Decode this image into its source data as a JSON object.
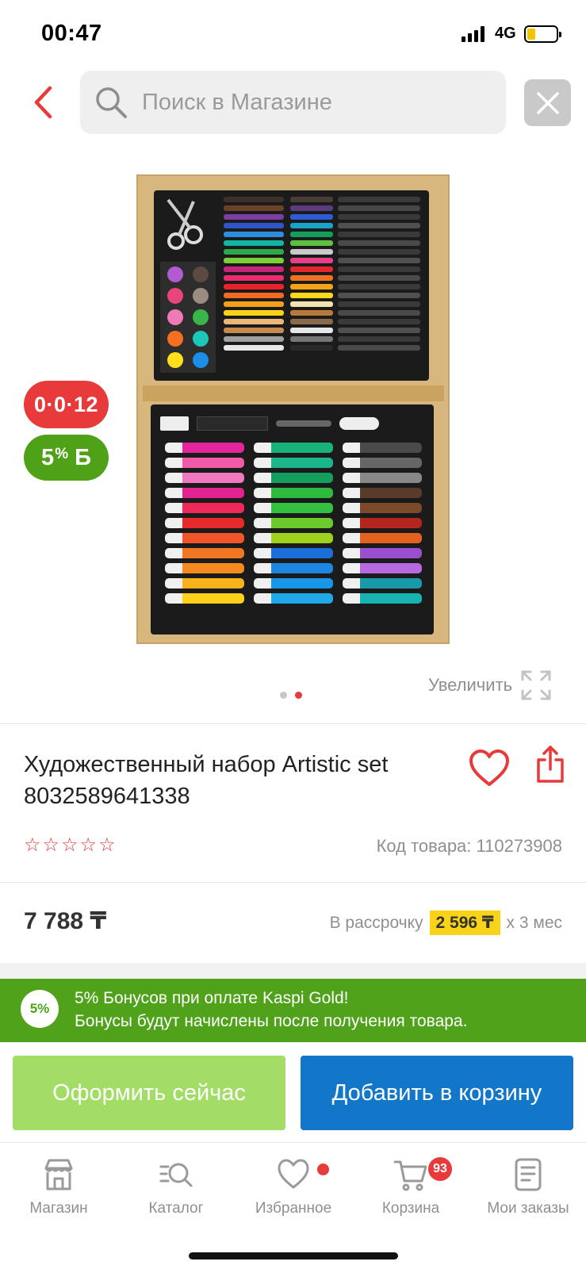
{
  "status_bar": {
    "time": "00:47",
    "network": "4G"
  },
  "search": {
    "placeholder": "Поиск в Магазине",
    "value": ""
  },
  "badges": {
    "installment": "0·0·12",
    "bonus_percent": "5",
    "bonus_percent_sign": "%",
    "bonus_currency": "Б"
  },
  "gallery": {
    "zoom_label": "Увеличить",
    "current_slide": 2,
    "total_slides": 2
  },
  "product": {
    "title": "Художественный набор Artistic set 8032589641338",
    "rating": 0,
    "rating_max": 5,
    "sku_label": "Код товара: 110273908",
    "price": "7 788 ₸",
    "installment_prefix": "В рассрочку",
    "installment_amount": "2 596 ₸",
    "installment_suffix": "х 3 мес"
  },
  "promo": {
    "circle_label": "5%",
    "line1": "5% Бонусов при оплате Kaspi Gold!",
    "line2": "Бонусы будут начислены после получения товара."
  },
  "actions": {
    "buy_now": "Оформить сейчас",
    "add_to_cart": "Добавить в корзину"
  },
  "tab_bar": {
    "items": [
      {
        "label": "Магазин",
        "icon": "store-icon"
      },
      {
        "label": "Каталог",
        "icon": "catalog-search-icon"
      },
      {
        "label": "Избранное",
        "icon": "heart-icon"
      },
      {
        "label": "Корзина",
        "icon": "cart-icon"
      },
      {
        "label": "Мои заказы",
        "icon": "orders-icon"
      }
    ],
    "cart_count": "93"
  },
  "colors": {
    "accent_red": "#e83a3a",
    "kaspi_green": "#50a21a",
    "buy_now_green": "#a4dd66",
    "kaspi_blue": "#1277c9",
    "installment_yellow": "#f8d318"
  }
}
